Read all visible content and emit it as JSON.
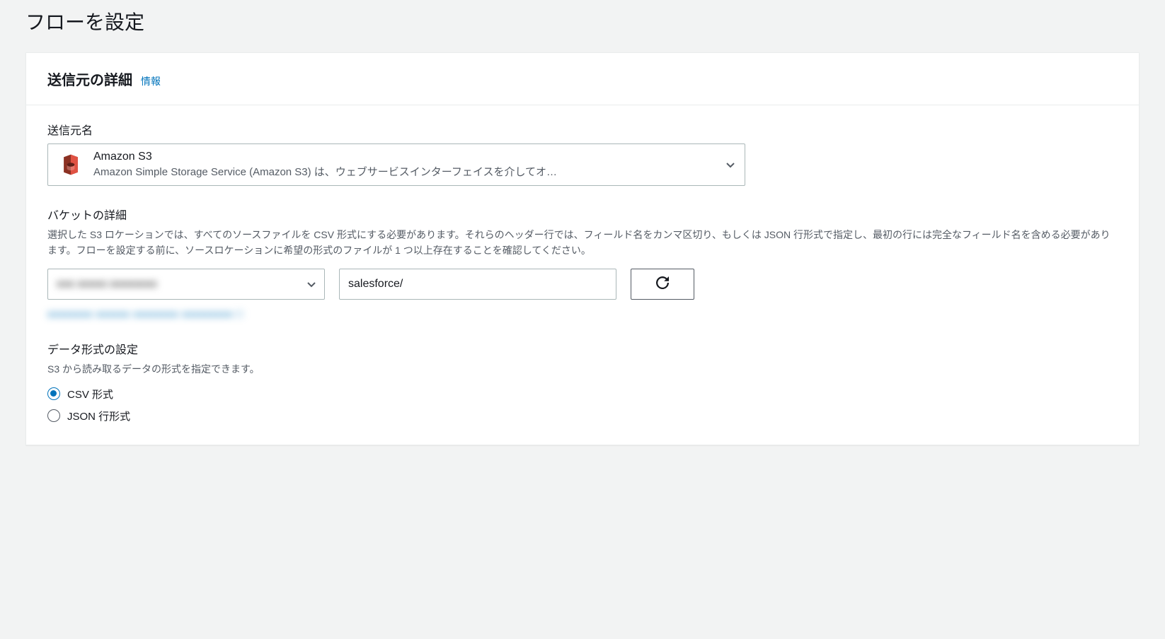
{
  "page": {
    "title": "フローを設定"
  },
  "panel": {
    "title": "送信元の詳細",
    "info": "情報"
  },
  "source": {
    "label": "送信元名",
    "selected": {
      "name": "Amazon S3",
      "desc": "Amazon Simple Storage Service (Amazon S3) は、ウェブサービスインターフェイスを介してオ…"
    }
  },
  "bucket": {
    "label": "バケットの詳細",
    "help": "選択した S3 ロケーションでは、すべてのソースファイルを CSV 形式にする必要があります。それらのヘッダー行では、フィールド名をカンマ区切り、もしくは JSON 行形式で指定し、最初の行には完全なフィールド名を含める必要があります。フローを設定する前に、ソースロケーションに希望の形式のファイルが 1 つ以上存在することを確認してください。",
    "selected_redacted": "xxx xxxxx xxxxxxxx",
    "prefix": "salesforce/",
    "link_redacted": "xxxxxxxx xxxxxx  xxxxxxxx xxxxxxxxx  □"
  },
  "format": {
    "label": "データ形式の設定",
    "help": "S3 から読み取るデータの形式を指定できます。",
    "options": {
      "csv": "CSV 形式",
      "json": "JSON 行形式"
    }
  }
}
